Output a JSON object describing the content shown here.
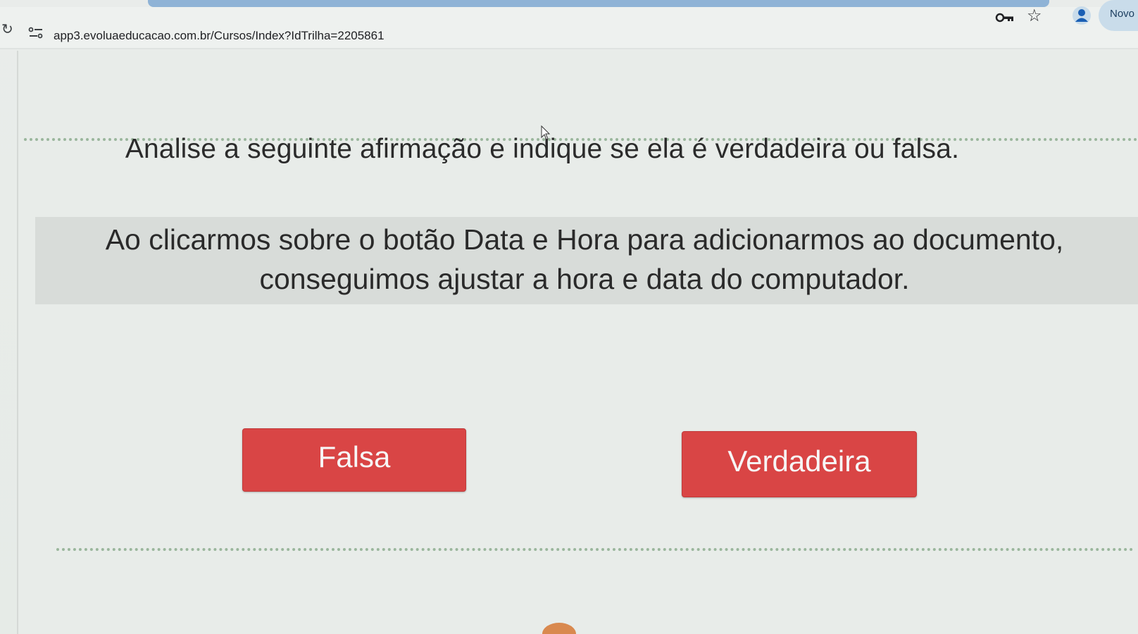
{
  "browser": {
    "url": "app3.evoluaeducacao.com.br/Cursos/Index?IdTrilha=2205861",
    "new_button_label": "Novo",
    "icons": {
      "reload": "reload-icon",
      "site_info": "site-info-icon",
      "password_key": "key-icon",
      "bookmark": "star-icon",
      "profile": "profile-icon"
    },
    "accent_color": "#8fb3d6"
  },
  "quiz": {
    "instruction": "Analise a seguinte afirmação e indique se ela é verdadeira ou falsa.",
    "statement_line1": "Ao clicarmos sobre o botão Data e Hora para adicionarmos ao documento,",
    "statement_line2": "conseguimos ajustar a hora e data do computador.",
    "false_label": "Falsa",
    "true_label": "Verdadeira",
    "button_color": "#d94545"
  }
}
